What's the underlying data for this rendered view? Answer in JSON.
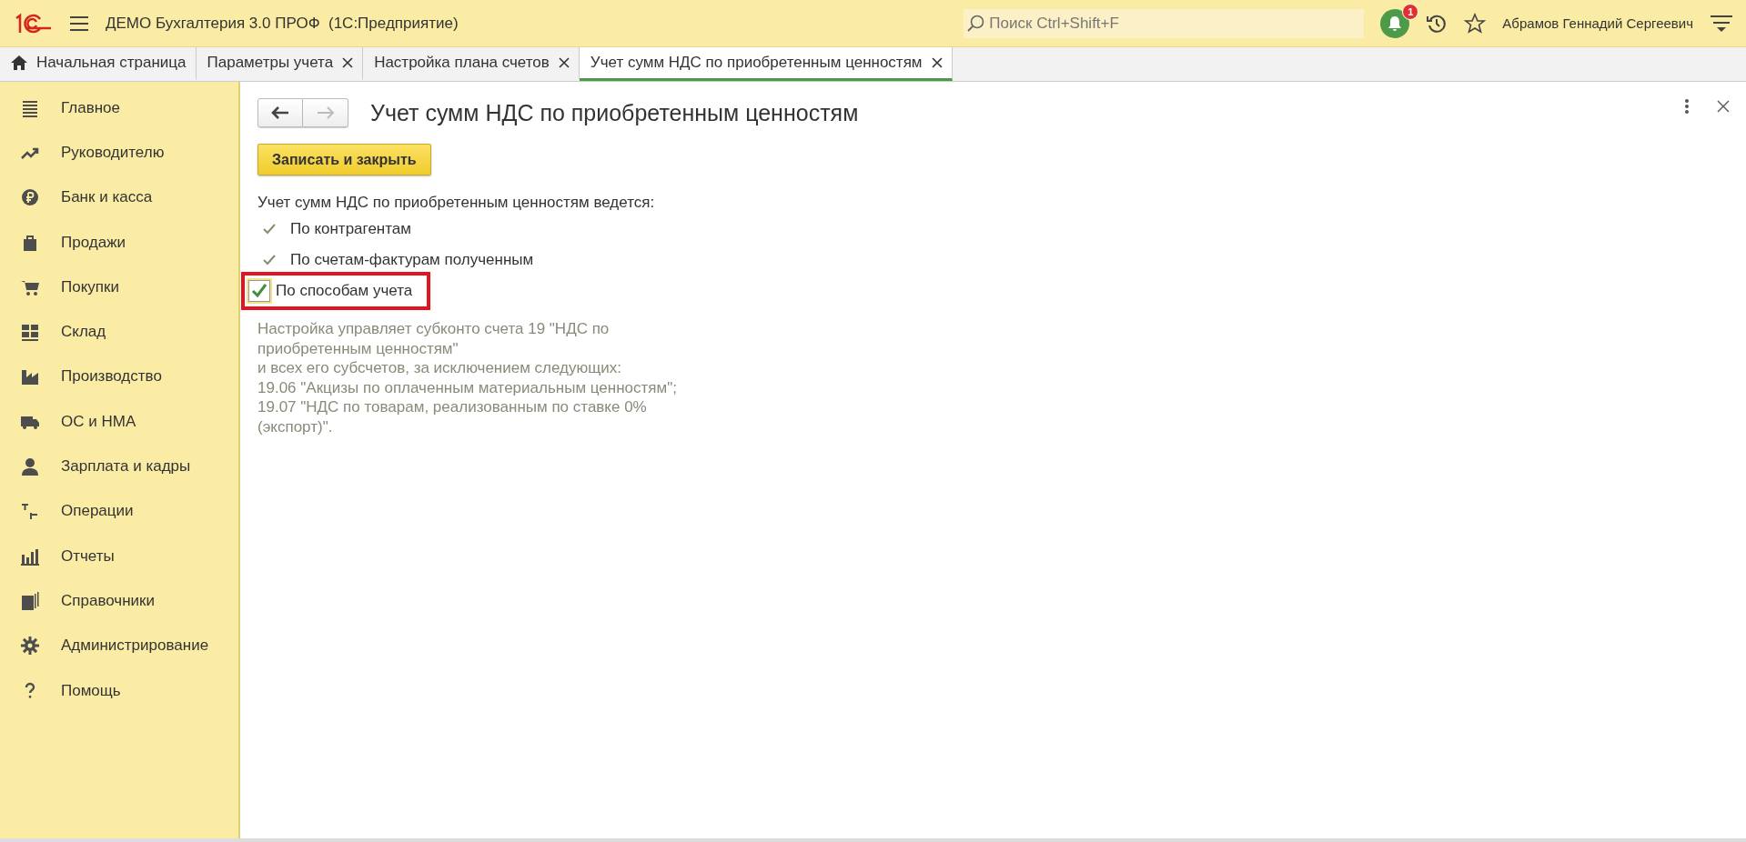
{
  "app_bar": {
    "title": "ДЕМО Бухгалтерия 3.0 ПРОФ  (1С:Предприятие)",
    "search": {
      "placeholder": "Поиск Ctrl+Shift+F"
    },
    "notification_count": "1",
    "user": "Абрамов Геннадий Сергеевич"
  },
  "tabs": [
    {
      "label": "Начальная страница",
      "selected": false,
      "kind": "home"
    },
    {
      "label": "Параметры учета",
      "selected": false,
      "kind": "closable"
    },
    {
      "label": "Настройка плана счетов",
      "selected": false,
      "kind": "closable"
    },
    {
      "label": "Учет сумм НДС по приобретенным ценностям",
      "selected": true,
      "kind": "closable"
    }
  ],
  "sidebar": {
    "items": [
      {
        "label": "Главное"
      },
      {
        "label": "Руководителю"
      },
      {
        "label": "Банк и касса"
      },
      {
        "label": "Продажи"
      },
      {
        "label": "Покупки"
      },
      {
        "label": "Склад"
      },
      {
        "label": "Производство"
      },
      {
        "label": "ОС и НМА"
      },
      {
        "label": "Зарплата и кадры"
      },
      {
        "label": "Операции"
      },
      {
        "label": "Отчеты"
      },
      {
        "label": "Справочники"
      },
      {
        "label": "Администрирование"
      },
      {
        "label": "Помощь"
      }
    ]
  },
  "form": {
    "title": "Учет сумм НДС по приобретенным ценностям",
    "save_button": "Записать и закрыть",
    "section_label": "Учет сумм НДС по приобретенным ценностям ведется:",
    "options": [
      {
        "kind": "check",
        "label": "По контрагентам",
        "checked": true
      },
      {
        "kind": "check",
        "label": "По счетам-фактурам полученным",
        "checked": true
      },
      {
        "kind": "checkbox",
        "label": "По способам учета",
        "checked": true,
        "highlighted": true
      }
    ],
    "note": [
      "Настройка управляет субконто счета 19 \"НДС по",
      "приобретенным ценностям\"",
      "и всех его субсчетов, за исключением следующих:",
      "19.06 \"Акцизы по оплаченным материальным ценностям\";",
      "19.07 \"НДС по товарам, реализованным по ставке 0%",
      "(экспорт)\"."
    ]
  }
}
